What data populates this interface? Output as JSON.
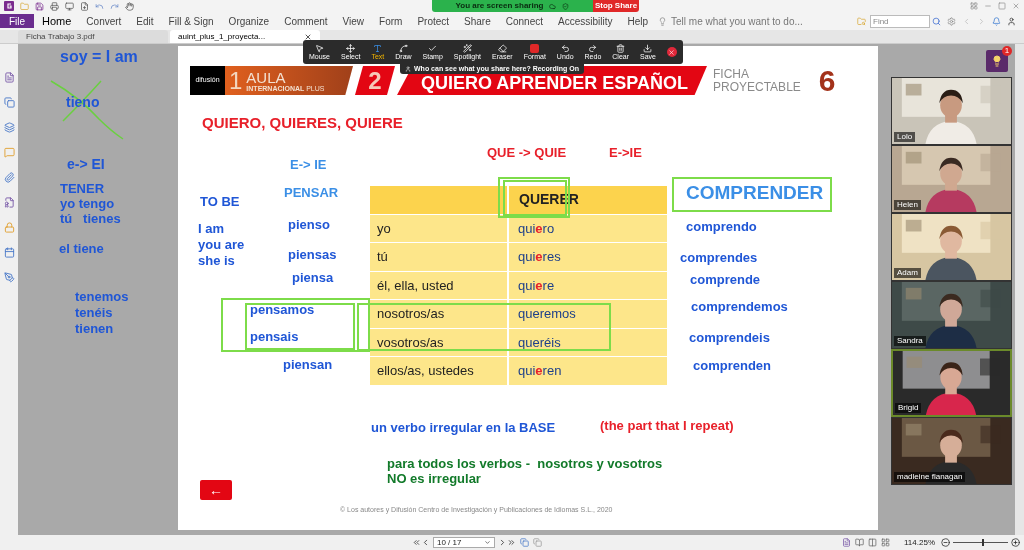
{
  "screen_share": {
    "text": "You are screen sharing",
    "stop_button": "Stop Share"
  },
  "menu": {
    "file": "File",
    "tabs": [
      {
        "label": "Home",
        "selected": true
      },
      {
        "label": "Convert",
        "selected": false
      },
      {
        "label": "Edit",
        "selected": false
      },
      {
        "label": "Fill & Sign",
        "selected": false
      },
      {
        "label": "Organize",
        "selected": false
      },
      {
        "label": "Comment",
        "selected": false
      },
      {
        "label": "View",
        "selected": false
      },
      {
        "label": "Form",
        "selected": false
      },
      {
        "label": "Protect",
        "selected": false
      },
      {
        "label": "Share",
        "selected": false
      },
      {
        "label": "Connect",
        "selected": false
      },
      {
        "label": "Accessibility",
        "selected": false
      },
      {
        "label": "Help",
        "selected": false
      }
    ],
    "tell_me": {
      "placeholder": "Tell me what you want to do..."
    },
    "find": {
      "placeholder": "Find"
    }
  },
  "document_tabs": [
    {
      "label": "Ficha Trabajo 3.pdf",
      "selected": false
    },
    {
      "label": "auint_plus_1_proyecta...",
      "selected": true
    }
  ],
  "annotation_toolbar": {
    "tools": [
      {
        "label": "Mouse",
        "selected": false
      },
      {
        "label": "Select",
        "selected": false
      },
      {
        "label": "Text",
        "selected": true
      },
      {
        "label": "Draw",
        "selected": false
      },
      {
        "label": "Stamp",
        "selected": false
      },
      {
        "label": "Spotlight",
        "selected": false
      },
      {
        "label": "Eraser",
        "selected": false
      },
      {
        "label": "Format",
        "selected": false
      },
      {
        "label": "Undo",
        "selected": false
      },
      {
        "label": "Redo",
        "selected": false
      },
      {
        "label": "Clear",
        "selected": false
      },
      {
        "label": "Save",
        "selected": false
      }
    ],
    "notice": "Who can see what you share here? Recording On"
  },
  "slide": {
    "logo": {
      "publisher": "difusión",
      "number": "1",
      "title": "AULA",
      "subtitle": "INTERNACIONAL",
      "suffix": "PLUS"
    },
    "unit": "2",
    "unit_title": "QUIERO APRENDER ESPAÑOL",
    "sheet_label": "FICHA",
    "sheet_label_2": "PROYECTABLE",
    "sheet_number": "6",
    "heading": "QUIERO, QUIERES, QUIERE",
    "table": {
      "header": "QUERER",
      "rows": [
        {
          "pronoun": "yo",
          "form": [
            {
              "text": "qui",
              "highlight": false
            },
            {
              "text": "e",
              "highlight": true
            },
            {
              "text": "ro",
              "highlight": false
            }
          ]
        },
        {
          "pronoun": "tú",
          "form": [
            {
              "text": "qui",
              "highlight": false
            },
            {
              "text": "e",
              "highlight": true
            },
            {
              "text": "res",
              "highlight": false
            }
          ]
        },
        {
          "pronoun": "él, ella, usted",
          "form": [
            {
              "text": "qui",
              "highlight": false
            },
            {
              "text": "e",
              "highlight": true
            },
            {
              "text": "re",
              "highlight": false
            }
          ]
        },
        {
          "pronoun": "nosotros/as",
          "form": [
            {
              "text": "queremos",
              "highlight": false
            }
          ]
        },
        {
          "pronoun": "vosotros/as",
          "form": [
            {
              "text": "queréis",
              "highlight": false
            }
          ]
        },
        {
          "pronoun": "ellos/as, ustedes",
          "form": [
            {
              "text": "qui",
              "highlight": false
            },
            {
              "text": "e",
              "highlight": true
            },
            {
              "text": "ren",
              "highlight": false
            }
          ]
        }
      ]
    },
    "back_button": "←",
    "copyright": "© Los autores y Difusión Centro de Investigación y Publicaciones de Idiomas S.L., 2020"
  },
  "annotations": [
    {
      "text": "soy = I am",
      "color": "#1f56d6"
    },
    {
      "text": "tieno",
      "color": "#1f56d6"
    },
    {
      "text": "e-> EI",
      "color": "#1f56d6"
    },
    {
      "text": "TENER",
      "color": "#1f56d6"
    },
    {
      "text": "yo tengo",
      "color": "#1f56d6"
    },
    {
      "text": "tú   tienes",
      "color": "#1f56d6"
    },
    {
      "text": "el tiene",
      "color": "#1f56d6"
    },
    {
      "text": "tenemos",
      "color": "#1f56d6"
    },
    {
      "text": "tenéis",
      "color": "#1f56d6"
    },
    {
      "text": "tienen",
      "color": "#1f56d6"
    },
    {
      "text": "E-> IE",
      "color": "#3b8fe6"
    },
    {
      "text": "QUE -> QUIE",
      "color": "#e8202a"
    },
    {
      "text": "E->IE",
      "color": "#e8202a"
    },
    {
      "text": "PENSAR",
      "color": "#3b8fe6"
    },
    {
      "text": "TO BE",
      "color": "#1f56d6"
    },
    {
      "text": "I am",
      "color": "#1f56d6"
    },
    {
      "text": "you are",
      "color": "#1f56d6"
    },
    {
      "text": "she is",
      "color": "#1f56d6"
    },
    {
      "text": "pienso",
      "color": "#1f56d6"
    },
    {
      "text": "piensas",
      "color": "#1f56d6"
    },
    {
      "text": "piensa",
      "color": "#1f56d6"
    },
    {
      "text": "pensamos",
      "color": "#1f56d6"
    },
    {
      "text": "pensais",
      "color": "#1f56d6"
    },
    {
      "text": "piensan",
      "color": "#1f56d6"
    },
    {
      "text": "COMPRENDER",
      "color": "#3b8fe6"
    },
    {
      "text": "comprendo",
      "color": "#1f56d6"
    },
    {
      "text": "comprendes",
      "color": "#1f56d6"
    },
    {
      "text": "comprende",
      "color": "#1f56d6"
    },
    {
      "text": "comprendemos",
      "color": "#1f56d6"
    },
    {
      "text": "comprendeis",
      "color": "#1f56d6"
    },
    {
      "text": "comprenden",
      "color": "#1f56d6"
    },
    {
      "text": "un verbo irregular en la BASE",
      "color": "#1f56d6"
    },
    {
      "text": "(the part that I repeat)",
      "color": "#e8202a"
    },
    {
      "text": "para todos los verbos -  nosotros y vosotros",
      "color": "#127a2a"
    },
    {
      "text": "NO es irregular",
      "color": "#127a2a"
    }
  ],
  "participants": [
    {
      "name": "Lolo",
      "speaking": false
    },
    {
      "name": "Helen",
      "speaking": false
    },
    {
      "name": "Adam",
      "speaking": false
    },
    {
      "name": "Sandra",
      "speaking": false
    },
    {
      "name": "Brigid",
      "speaking": true
    },
    {
      "name": "madleine flanagan",
      "speaking": false
    }
  ],
  "tips_badge": "1",
  "status_bar": {
    "page": "10 / 17",
    "zoom": "114.25%",
    "zoom_slider": {
      "level": 0.55
    }
  }
}
